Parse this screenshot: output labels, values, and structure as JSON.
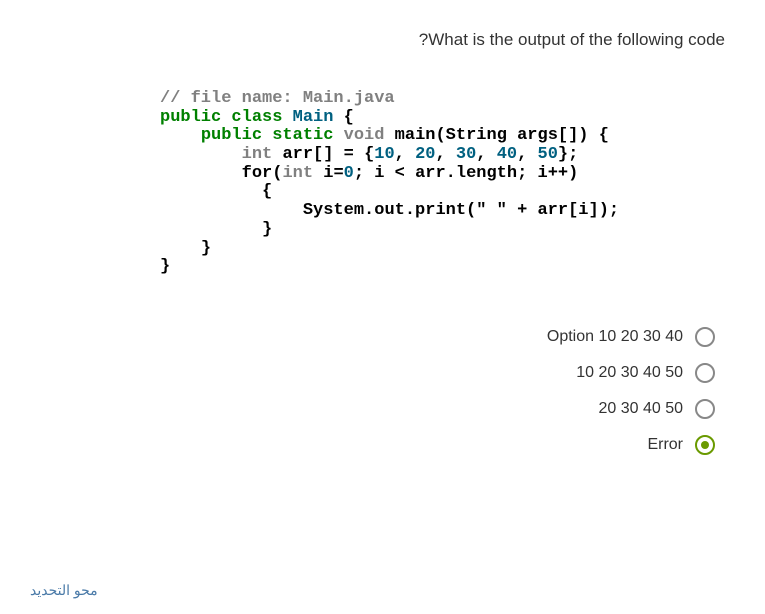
{
  "question": {
    "title": "?What is the output of the following code"
  },
  "code": {
    "comment": "// file name: Main.java",
    "kw_public1": "public",
    "kw_class": "class",
    "classname": "Main",
    "brace_open1": "{",
    "kw_public2": "public",
    "kw_static": "static",
    "kw_void": "void",
    "method_main": "main(String args",
    "args_end": "[]) {",
    "kw_int": "int",
    "arr_decl": "arr",
    "brackets": "[]",
    "equals": " = ",
    "arr_open": "{",
    "n10": "10",
    "n20": "20",
    "n30": "30",
    "n40": "40",
    "n50": "50",
    "arr_close": "};",
    "for_decl": "for(",
    "kw_int2": "int",
    "i_eq": " i=",
    "zero": "0",
    "for_mid": "; i < arr.length; i++)",
    "brace_open2": "{",
    "sysout": "System.out.print(",
    "str": "\" \"",
    "plus_arr": " + arr[i]);",
    "brace_close1": "}",
    "brace_close2": "}",
    "brace_close3": "}"
  },
  "options": [
    {
      "label": "Option 10 20 30 40",
      "selected": false
    },
    {
      "label": "10 20 30 40 50",
      "selected": false
    },
    {
      "label": "20 30 40 50",
      "selected": false
    },
    {
      "label": "Error",
      "selected": true
    }
  ],
  "clear_selection": "محو التحديد"
}
